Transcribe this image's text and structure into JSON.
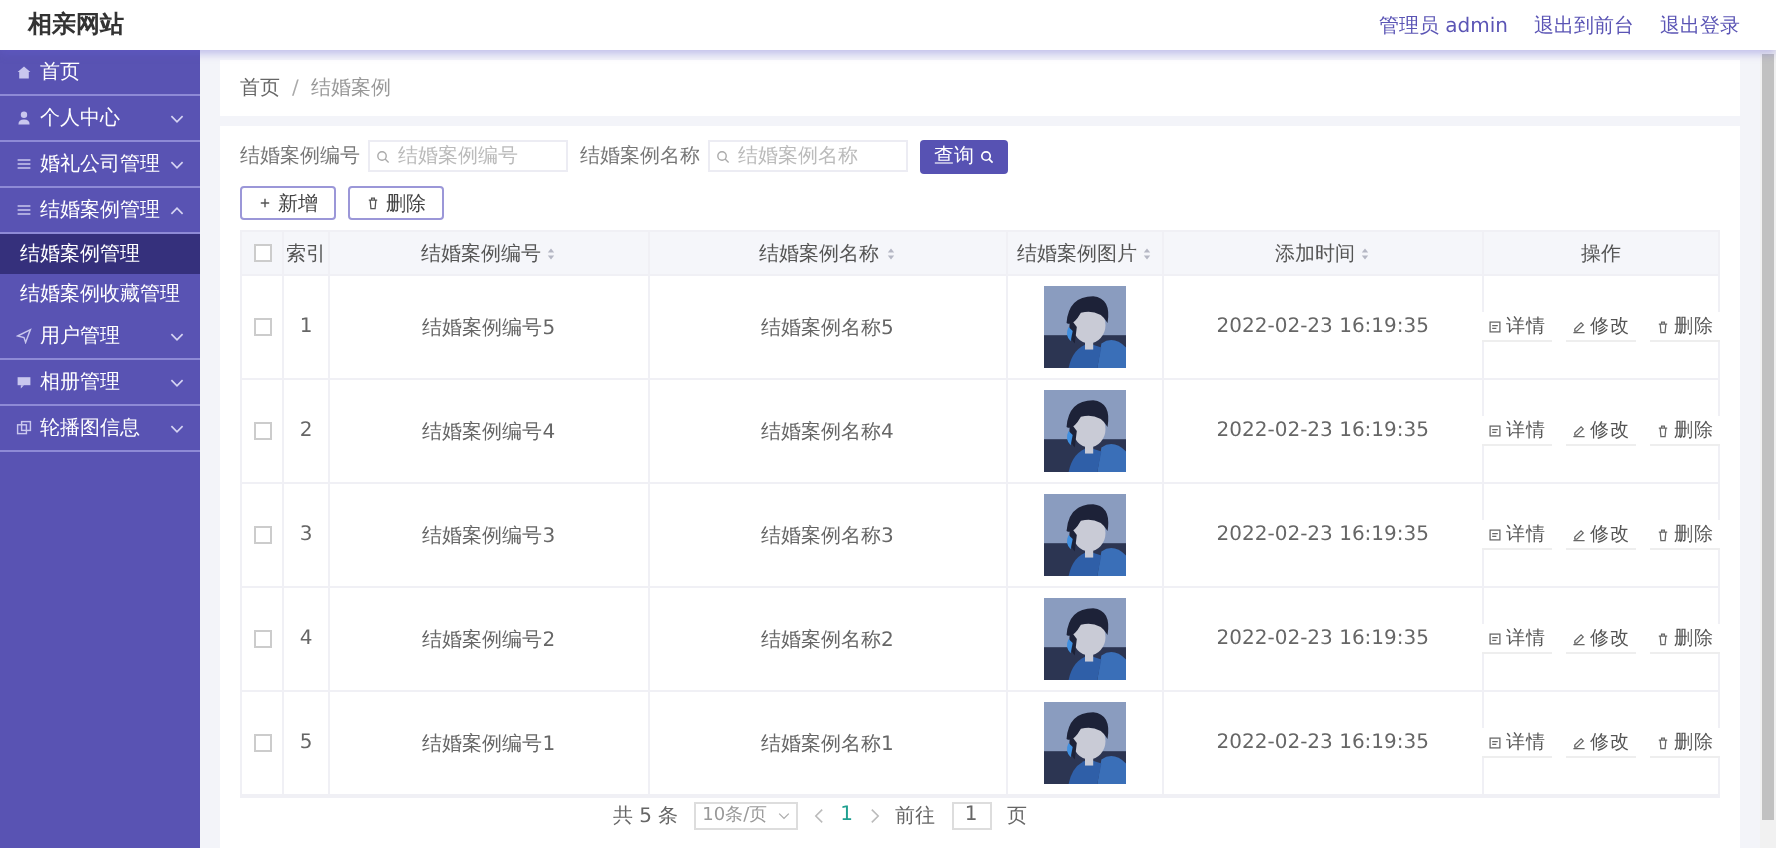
{
  "site_title": "相亲网站",
  "header_links": [
    "管理员 admin",
    "退出到前台",
    "退出登录"
  ],
  "sidebar": {
    "items": [
      {
        "label": "首页"
      },
      {
        "label": "个人中心",
        "expanded": false
      },
      {
        "label": "婚礼公司管理",
        "expanded": false
      },
      {
        "label": "结婚案例管理",
        "expanded": true,
        "children": [
          {
            "label": "结婚案例管理",
            "selected": true
          },
          {
            "label": "结婚案例收藏管理",
            "selected": false
          }
        ]
      },
      {
        "label": "用户管理",
        "expanded": false
      },
      {
        "label": "相册管理",
        "expanded": false
      },
      {
        "label": "轮播图信息",
        "expanded": false
      }
    ]
  },
  "breadcrumb": {
    "items": [
      "首页",
      "结婚案例"
    ],
    "separator": "/"
  },
  "search": {
    "fields": [
      {
        "label": "结婚案例编号",
        "placeholder": "结婚案例编号"
      },
      {
        "label": "结婚案例名称",
        "placeholder": "结婚案例名称"
      }
    ],
    "button": "查询"
  },
  "toolbar": [
    "新增",
    "删除"
  ],
  "table": {
    "header_checked": false,
    "columns": [
      {
        "label": "索引",
        "sortable": false
      },
      {
        "label": "结婚案例编号",
        "sortable": true
      },
      {
        "label": "结婚案例名称",
        "sortable": true
      },
      {
        "label": "结婚案例图片",
        "sortable": true
      },
      {
        "label": "添加时间",
        "sortable": true
      },
      {
        "label": "操作",
        "sortable": false
      }
    ],
    "rows": [
      {
        "checked": false,
        "index": "1",
        "number": "结婚案例编号5",
        "name": "结婚案例名称5",
        "time": "2022-02-23 16:19:35",
        "actions": [
          "详情",
          "修改",
          "删除"
        ]
      },
      {
        "checked": false,
        "index": "2",
        "number": "结婚案例编号4",
        "name": "结婚案例名称4",
        "time": "2022-02-23 16:19:35",
        "actions": [
          "详情",
          "修改",
          "删除"
        ]
      },
      {
        "checked": false,
        "index": "3",
        "number": "结婚案例编号3",
        "name": "结婚案例名称3",
        "time": "2022-02-23 16:19:35",
        "actions": [
          "详情",
          "修改",
          "删除"
        ]
      },
      {
        "checked": false,
        "index": "4",
        "number": "结婚案例编号2",
        "name": "结婚案例名称2",
        "time": "2022-02-23 16:19:35",
        "actions": [
          "详情",
          "修改",
          "删除"
        ]
      },
      {
        "checked": false,
        "index": "5",
        "number": "结婚案例编号1",
        "name": "结婚案例名称1",
        "time": "2022-02-23 16:19:35",
        "actions": [
          "详情",
          "修改",
          "删除"
        ]
      }
    ]
  },
  "pagination": {
    "total": "共 5 条",
    "page_size": "10条/页",
    "pages": [
      {
        "label": "1",
        "selected": true
      }
    ],
    "goto_label": "前往",
    "goto_value": "1",
    "goto_suffix": "页"
  }
}
